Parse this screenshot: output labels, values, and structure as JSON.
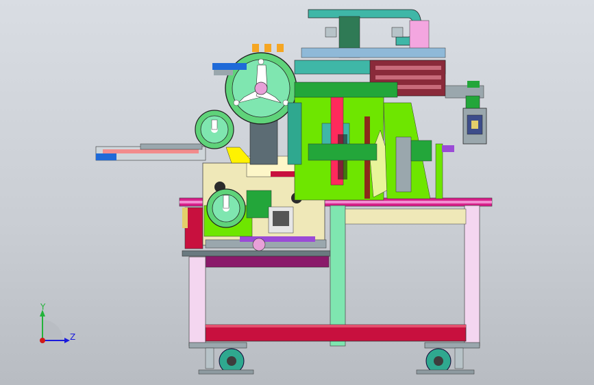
{
  "viewport": {
    "background_top": "#d9dde3",
    "background_bottom": "#b8bcc2"
  },
  "triad": {
    "y_label": "Y",
    "z_label": "Z",
    "y_color": "#23b33a",
    "z_color": "#1a1adc",
    "origin_color": "#d11a1a"
  },
  "model": {
    "description_colors": {
      "frame_white": "#f4d6f0",
      "frame_green": "#7fe6b0",
      "beam_magenta": "#d8208a",
      "crossbar_red": "#c8103e",
      "panel_lime": "#6ee600",
      "panel_teal": "#3fb7a7",
      "panel_cream": "#efe8b8",
      "reel_green": "#5fd37a",
      "plate_grey": "#9aa7ad",
      "accent_purple": "#9b4bd6",
      "accent_blue": "#1f6ad8"
    }
  }
}
